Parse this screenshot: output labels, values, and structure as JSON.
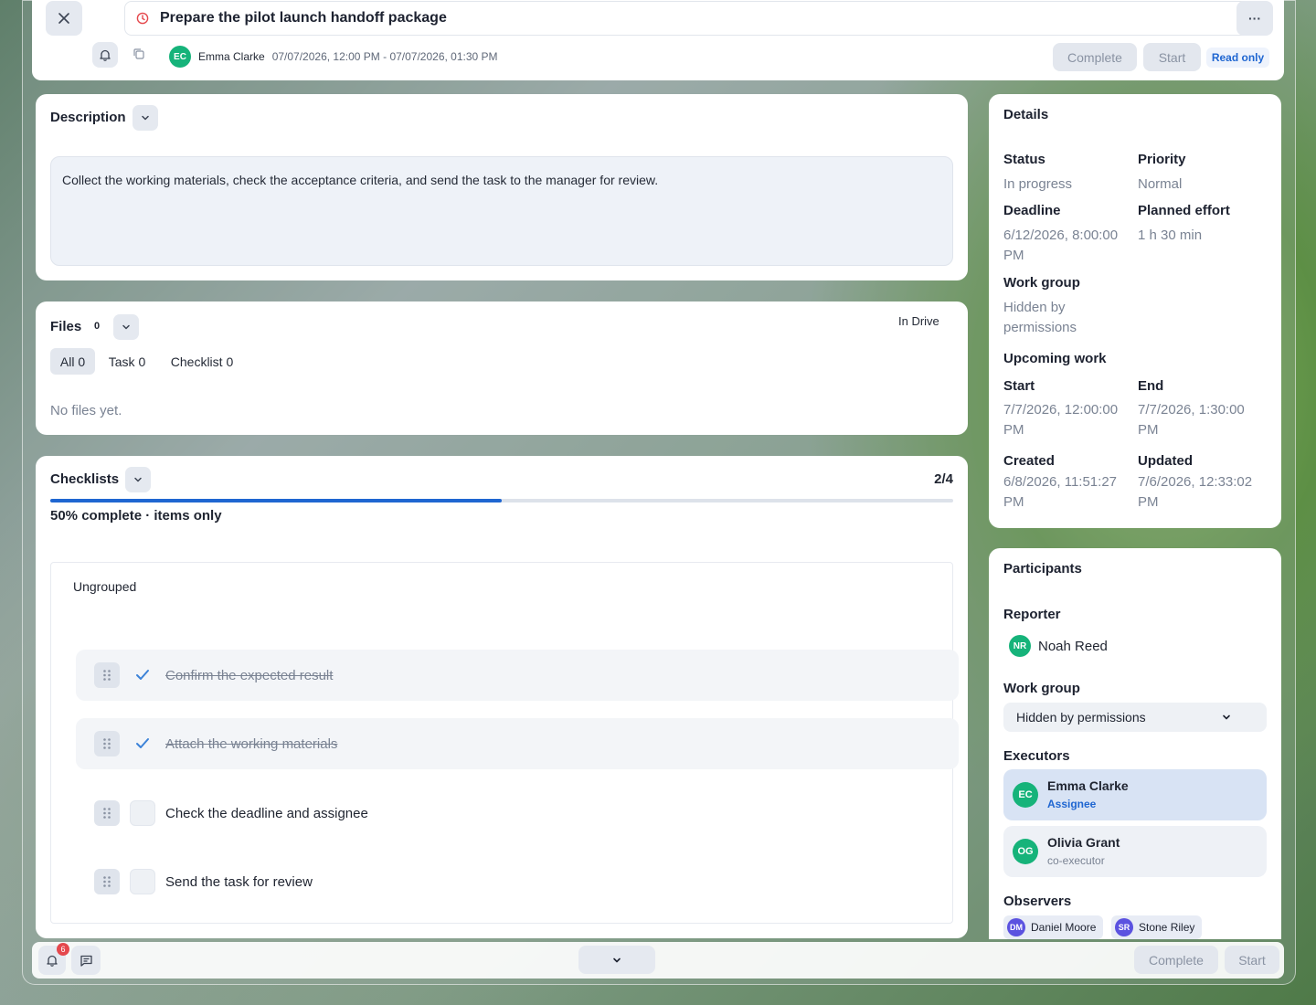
{
  "header": {
    "title": "Prepare the pilot launch handoff package",
    "assignee_initials": "EC",
    "assignee_name": "Emma Clarke",
    "time_range": "07/07/2026, 12:00 PM - 07/07/2026, 01:30 PM",
    "complete_label": "Complete",
    "start_label": "Start",
    "readonly_label": "Read only",
    "more_label": "···"
  },
  "description": {
    "title": "Description",
    "text": "Collect the working materials, check the acceptance criteria, and send the task to the manager for review."
  },
  "files": {
    "title": "Files",
    "count": "0",
    "drive_label": "In Drive",
    "tabs": [
      "All 0",
      "Task 0",
      "Checklist 0"
    ],
    "empty_text": "No files yet."
  },
  "checklists": {
    "title": "Checklists",
    "counter": "2/4",
    "progress_fraction": 0.5,
    "progress_text": "50% complete · items only",
    "group_label": "Ungrouped",
    "items": [
      {
        "text": "Confirm the expected result",
        "done": true
      },
      {
        "text": "Attach the working materials",
        "done": true
      },
      {
        "text": "Check the deadline and assignee",
        "done": false
      },
      {
        "text": "Send the task for review",
        "done": false
      }
    ]
  },
  "details": {
    "title": "Details",
    "status_label": "Status",
    "status_value": "In progress",
    "priority_label": "Priority",
    "priority_value": "Normal",
    "deadline_label": "Deadline",
    "deadline_value": "6/12/2026, 8:00:00 PM",
    "effort_label": "Planned effort",
    "effort_value": "1 h 30 min",
    "workgroup_label": "Work group",
    "workgroup_value": "Hidden by permissions",
    "upcoming_label": "Upcoming work",
    "start_label": "Start",
    "start_value": "7/7/2026, 12:00:00 PM",
    "end_label": "End",
    "end_value": "7/7/2026, 1:30:00 PM",
    "created_label": "Created",
    "created_value": "6/8/2026, 11:51:27 PM",
    "updated_label": "Updated",
    "updated_value": "7/6/2026, 12:33:02 PM"
  },
  "participants": {
    "title": "Participants",
    "reporter_label": "Reporter",
    "reporter_initials": "NR",
    "reporter_name": "Noah Reed",
    "workgroup_label": "Work group",
    "workgroup_value": "Hidden by permissions",
    "executors_label": "Executors",
    "executors": [
      {
        "initials": "EC",
        "name": "Emma Clarke",
        "role": "Assignee"
      },
      {
        "initials": "OG",
        "name": "Olivia Grant",
        "role": "co-executor"
      }
    ],
    "observers_label": "Observers",
    "observers": [
      {
        "initials": "DM",
        "name": "Daniel Moore"
      },
      {
        "initials": "SR",
        "name": "Stone Riley"
      }
    ]
  },
  "footer": {
    "notification_count": "6",
    "complete_label": "Complete",
    "start_label": "Start"
  },
  "colors": {
    "accent": "#1f66d1",
    "avatar_green": "#16b37a",
    "avatar_indigo": "#5b52e0",
    "badge_red": "#e5484d"
  }
}
